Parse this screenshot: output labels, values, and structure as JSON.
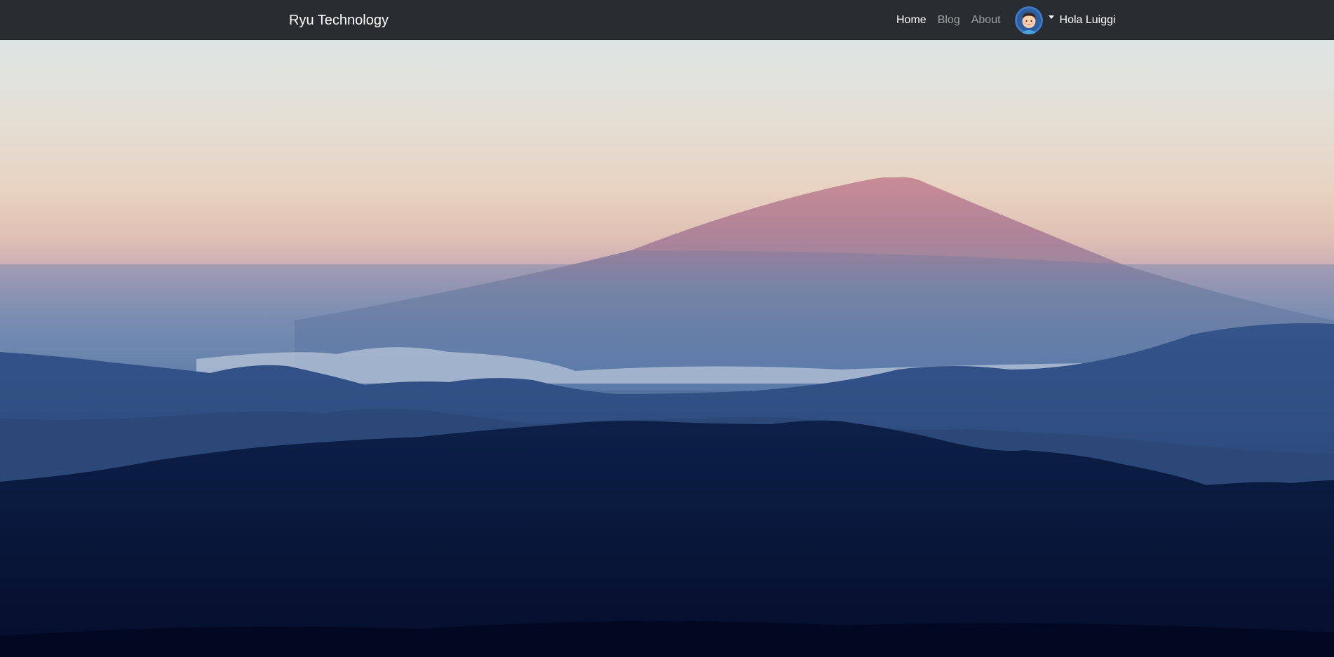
{
  "navbar": {
    "brand": "Ryu Technology",
    "links": [
      {
        "label": "Home",
        "active": true
      },
      {
        "label": "Blog",
        "active": false
      },
      {
        "label": "About",
        "active": false
      }
    ],
    "user": {
      "greeting": "Hola Luiggi",
      "avatar_icon": "user-avatar-icon"
    },
    "colors": {
      "background": "#292d31",
      "link_active": "#ffffff",
      "link_inactive": "#a6a8aa"
    }
  },
  "hero": {
    "image": "mountain-landscape-image"
  }
}
